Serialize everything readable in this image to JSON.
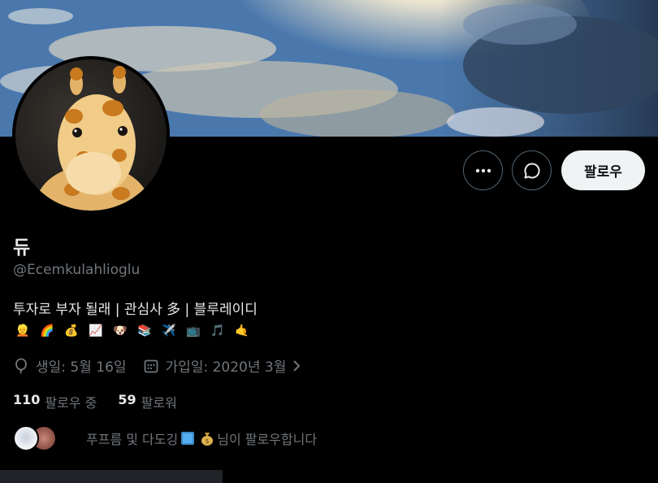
{
  "profile": {
    "name": "듀",
    "handle": "@Ecemkulahlioglu",
    "bio": "투자로 부자 될래 | 관심사 多 | 블루레이디",
    "bio_emojis": [
      "👱",
      "🌈",
      "💰",
      "📈",
      "🐶",
      "📚",
      "✈️",
      "📺",
      "🎵",
      "🤙"
    ],
    "birthday": "생일: 5월 16일",
    "joined": "가입일: 2020년 3월"
  },
  "actions": {
    "more_icon": "more-icon",
    "dm_icon": "message-icon",
    "follow_label": "팔로우"
  },
  "stats": {
    "following_count": "110",
    "following_label": "팔로우 중",
    "followers_count": "59",
    "followers_label": "팔로워"
  },
  "followed_by": {
    "prefix": "푸프름 및 다도깅",
    "suffix": "님이 팔로우합니다"
  },
  "colors": {
    "background": "#000000",
    "text_primary": "#e7e9ea",
    "text_secondary": "#71767b",
    "follow_button": "#eff3f4",
    "border": "#536471"
  }
}
